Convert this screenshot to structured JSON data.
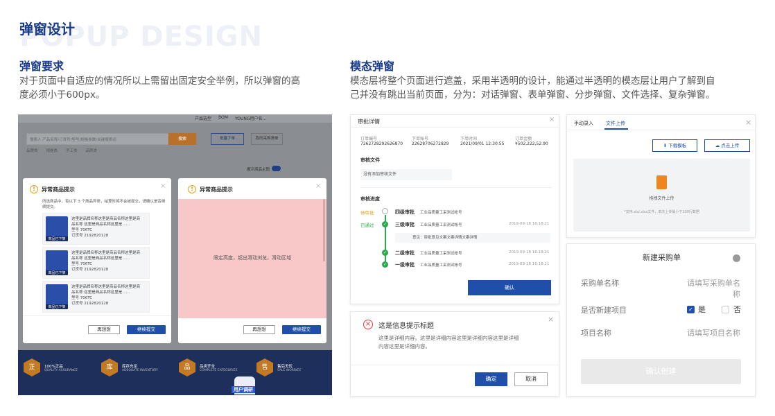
{
  "header": {
    "title": "弹窗设计",
    "bg_title": "POPUP DESIGN"
  },
  "left_section": {
    "title": "弹窗要求",
    "desc_line1": "对于页面中自适应的情况所以上需留出固定安全举例，所以弹窗的高",
    "desc_line2": "度必须小于600px。"
  },
  "right_section": {
    "title": "模态弹窗",
    "desc_line1": "模态层将整个页面进行遮盖，采用半透明的设计，能通过半透明的模态层让用户了解到自",
    "desc_line2": "己并没有跳出当前页面，分为：对话弹窗、表单弹窗、分步弹窗、文件选择、复杂弹窗。"
  },
  "left_shot": {
    "topbar": [
      "产品选型",
      "BOM",
      "YOUNG用户名…"
    ],
    "search_placeholder": "搜索人 产品名称/订货号/型号/规格参数/关键搜索词",
    "search_btn": "搜索",
    "compare_btn": "批量下单",
    "cart_btn": "我的采购清单",
    "filter_tags": [
      "品牌类",
      "规格类",
      "手工类",
      "品牌类"
    ],
    "toggle_label": "展示商品主图",
    "dialog_a": {
      "title": "异常商品提示",
      "intro": "所选商品中，有以下 3 个商品异常，结算时将不会被提交，请确认是否继续提交。",
      "items": [
        {
          "line1": "这里是品牌名称这里是商品名称这里是商",
          "line2": "品名称 这里是商品名称这里是……",
          "model": "型号    706TC",
          "order": "订货号  2192820128",
          "thumb": "商品已下架"
        },
        {
          "line1": "这里是品牌名称这里是商品名称这里是商",
          "line2": "品名称 这里是商品名称这里是……",
          "model": "型号    706TC",
          "order": "订货号  2192820128",
          "thumb": "商品已下架"
        },
        {
          "line1": "这里是品牌名称这里是商品名称这里是商",
          "line2": "品名称 这里是商品名称这里是……",
          "model": "型号    706TC",
          "order": "订货号  2192820128",
          "thumb": "商品已下架"
        }
      ],
      "cancel": "再想想",
      "confirm": "继续提交"
    },
    "dialog_b": {
      "title": "异常商品提示",
      "body": "限定高度，超出滑动浏览，滑动区域",
      "cancel": "再想想",
      "confirm": "继续提交"
    },
    "footer": [
      {
        "icon": "正",
        "cn": "100%正品",
        "en": "QUALITY ASSURANCE"
      },
      {
        "icon": "库",
        "cn": "库存充足",
        "en": "ADEQUATE INVENTORY"
      },
      {
        "icon": "品",
        "cn": "品类齐全",
        "en": "COMPLETE CATEGORIES"
      },
      {
        "icon": "售",
        "cn": "售后无忧",
        "en": "SALE WORRIES"
      }
    ],
    "mascot_label": "用户调研"
  },
  "approval": {
    "title": "审批详情",
    "cols": [
      {
        "label": "订单编号",
        "value": "7262728292626870"
      },
      {
        "label": "下单账号",
        "value": "22628706272829"
      },
      {
        "label": "下单时间",
        "value": "2021/09/01 12:30:55"
      },
      {
        "label": "订单金额",
        "value": "¥502,222,52.90"
      }
    ],
    "files_title": "审核文件",
    "files_empty": "没有添加审核文件",
    "progress_title": "审核进度",
    "steps": [
      {
        "status": "待审批",
        "level": "四级审批",
        "who": "工业品质量工采测试帐号",
        "time": ""
      },
      {
        "status": "已通过",
        "level": "三级审批",
        "who": "工业品质量工采测试帐号",
        "time": "2019-09-18 16:18:21"
      },
      {
        "status": "",
        "level": "二级审批",
        "who": "工业品质量工采测试帐号",
        "time": "2019-09-18 16:18:21"
      },
      {
        "status": "",
        "level": "一级审批",
        "who": "工业品质量工采测试帐号",
        "time": "2019-09-18 16:18:21"
      }
    ],
    "opinion": "意见：审批意见文案文案详情文案详情",
    "confirm": "确认"
  },
  "info_dialog": {
    "title": "这是信息提示标题",
    "body_line1": "这里是详细内容。这里是详细内容这里是详细内容这里是详细",
    "body_line2": "内容这里是详细内容。",
    "ok": "确定",
    "cancel": "取消"
  },
  "upload": {
    "tabs": [
      "手动录入",
      "文件上传"
    ],
    "download_btn": "下载模板",
    "upload_btn": "点击上传",
    "drop_label": "拖拽文件上传",
    "hint": "*支持.xls/.xlsx文件，单次上传最小于100行数据"
  },
  "purchase": {
    "title": "新建采购单",
    "name_label": "采购单名称",
    "name_placeholder": "请填写采购单名称",
    "new_label": "是否新建项目",
    "yes": "是",
    "no": "否",
    "proj_label": "项目名称",
    "proj_placeholder": "请填写项目名称",
    "submit": "确认创建"
  }
}
